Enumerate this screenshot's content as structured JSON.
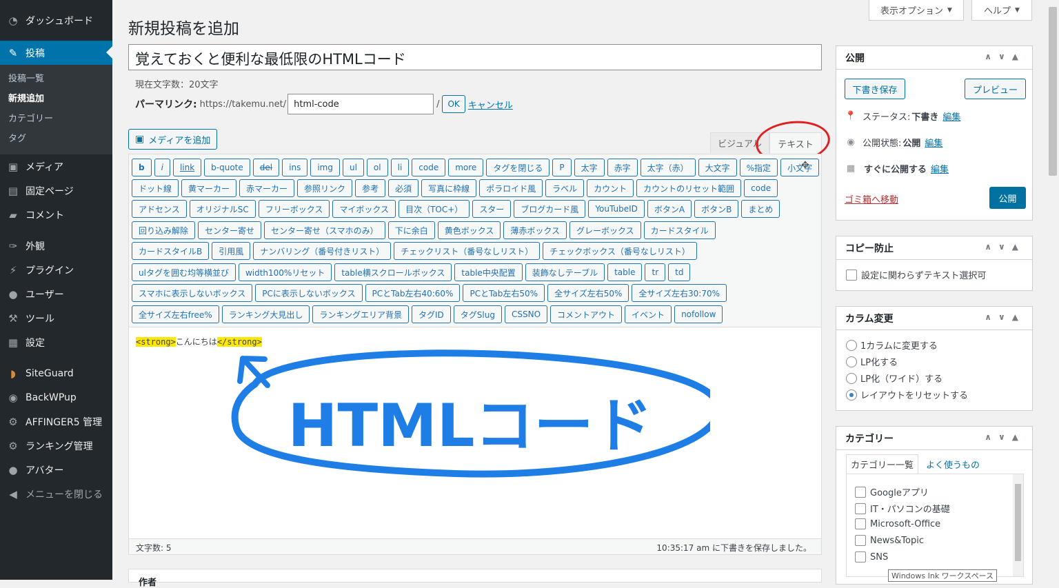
{
  "sidebar": {
    "items": [
      {
        "label": "ダッシュボード",
        "icon": "dashboard-icon"
      },
      {
        "label": "投稿",
        "icon": "pin-icon"
      },
      {
        "label": "メディア",
        "icon": "media-icon"
      },
      {
        "label": "固定ページ",
        "icon": "page-icon"
      },
      {
        "label": "コメント",
        "icon": "comment-icon"
      },
      {
        "label": "外観",
        "icon": "appearance-icon"
      },
      {
        "label": "プラグイン",
        "icon": "plugin-icon"
      },
      {
        "label": "ユーザー",
        "icon": "user-icon"
      },
      {
        "label": "ツール",
        "icon": "wrench-icon"
      },
      {
        "label": "設定",
        "icon": "settings-icon"
      },
      {
        "label": "SiteGuard",
        "icon": "siteguard-icon"
      },
      {
        "label": "BackWPup",
        "icon": "backwpup-icon"
      },
      {
        "label": "AFFINGER5 管理",
        "icon": "gear-icon"
      },
      {
        "label": "ランキング管理",
        "icon": "gear-icon"
      },
      {
        "label": "アバター",
        "icon": "avatar-icon"
      },
      {
        "label": "メニューを閉じる",
        "icon": "collapse-icon"
      }
    ],
    "submenu": [
      "投稿一覧",
      "新規追加",
      "カテゴリー",
      "タグ"
    ]
  },
  "top_tabs": {
    "screen_options": "表示オプション",
    "help": "ヘルプ"
  },
  "editor": {
    "page_title": "新規投稿を追加",
    "post_title": "覚えておくと便利な最低限のHTMLコード",
    "char_count": "現在文字数：20文字",
    "permalink_label": "パーマリンク:",
    "permalink_base": "https://takemu.net/",
    "slug": "html-code",
    "ok": "OK",
    "cancel": "キャンセル",
    "add_media": "メディアを追加",
    "tab_visual": "ビジュアル",
    "tab_text": "テキスト",
    "code_open": "<strong>",
    "code_text": "こんにちは",
    "code_close": "</strong>",
    "annotation": "HTMLコード",
    "word_count": "文字数: 5",
    "saved": "10:35:17 am に下書きを保存しました。"
  },
  "quicktags": [
    [
      "b",
      "i",
      "link",
      "b-quote",
      "del",
      "ins",
      "img",
      "ul",
      "ol",
      "li",
      "code",
      "more",
      "タグを閉じる",
      "P",
      "太字",
      "赤字",
      "太字（赤）",
      "大文字",
      "%指定",
      "小文字"
    ],
    [
      "ドット線",
      "黄マーカー",
      "赤マーカー",
      "参照リンク",
      "参考",
      "必須",
      "写真に枠線",
      "ポラロイド風",
      "ラベル",
      "カウント",
      "カウントのリセット範囲",
      "code"
    ],
    [
      "アドセンス",
      "オリジナルSC",
      "フリーボックス",
      "マイボックス",
      "目次（TOC+）",
      "スター",
      "ブログカード風",
      "YouTubeID",
      "ボタンA",
      "ボタンB",
      "まとめ"
    ],
    [
      "回り込み解除",
      "センター寄せ",
      "センター寄せ（スマホのみ）",
      "下に余白",
      "黄色ボックス",
      "薄赤ボックス",
      "グレーボックス",
      "カードスタイル"
    ],
    [
      "カードスタイルB",
      "引用風",
      "ナンバリング（番号付きリスト）",
      "チェックリスト（番号なしリスト）",
      "チェックボックス（番号なしリスト）"
    ],
    [
      "ulタグを囲む均等横並び",
      "width100%リセット",
      "table横スクロールボックス",
      "table中央配置",
      "装飾なしテーブル",
      "table",
      "tr",
      "td"
    ],
    [
      "スマホに表示しないボックス",
      "PCに表示しないボックス",
      "PCとTab左右40:60%",
      "PCとTab左右50%",
      "全サイズ左右50%",
      "全サイズ左右30:70%"
    ],
    [
      "全サイズ左右free%",
      "ランキング大見出し",
      "ランキングエリア背景",
      "タグID",
      "タグSlug",
      "CSSNO",
      "コメントアウト",
      "イベント",
      "nofollow"
    ]
  ],
  "publish": {
    "title": "公開",
    "save_draft": "下書き保存",
    "preview": "プレビュー",
    "status_label": "ステータス:",
    "status_value": "下書き",
    "visibility_label": "公開状態:",
    "visibility_value": "公開",
    "schedule_label": "すぐに公開する",
    "edit": "編集",
    "trash": "ゴミ箱へ移動",
    "publish": "公開"
  },
  "copy_protect": {
    "title": "コピー防止",
    "option": "設定に関わらずテキスト選択可"
  },
  "column_change": {
    "title": "カラム変更",
    "options": [
      "1カラムに変更する",
      "LP化する",
      "LP化（ワイド）する",
      "レイアウトをリセットする"
    ],
    "selected": 3
  },
  "category": {
    "title": "カテゴリー",
    "tab_all": "カテゴリー一覧",
    "tab_popular": "よく使うもの",
    "items": [
      "Googleアプリ",
      "IT・パソコンの基礎",
      "Microsoft-Office",
      "News&Topic",
      "SNS"
    ]
  },
  "next_box_title": "作者",
  "tooltip": "Windows Ink ワークスペース",
  "colors": {
    "sidebar": "#23282d",
    "accent": "#0073aa",
    "highlight": "#ffe800",
    "annotation_blue": "#1e7ee6",
    "circle_red": "#e02020"
  }
}
